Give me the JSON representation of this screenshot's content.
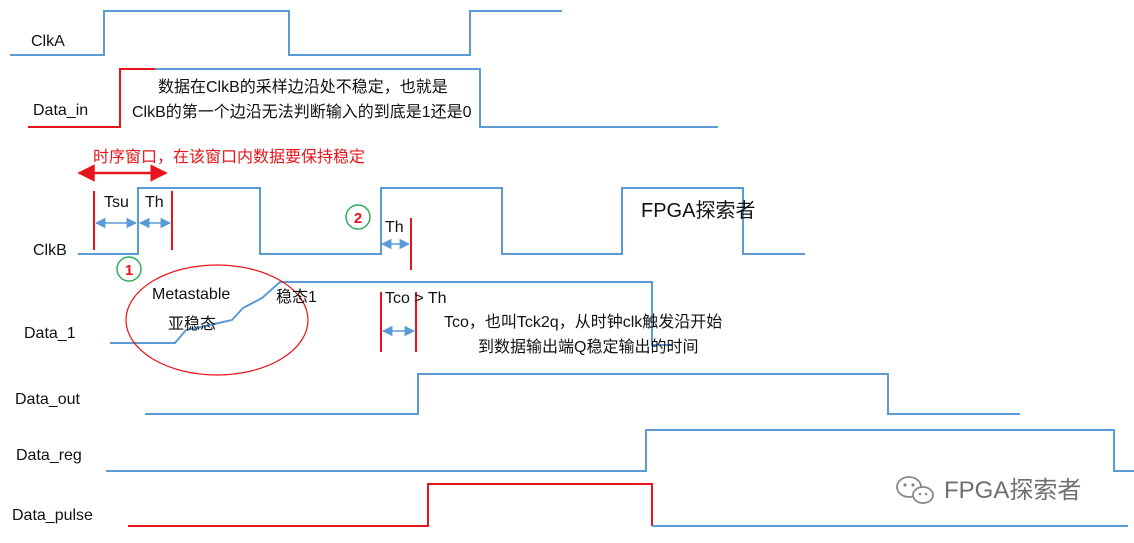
{
  "signals": {
    "clka": "ClkA",
    "data_in": "Data_in",
    "clkb": "ClkB",
    "data_1": "Data_1",
    "data_out": "Data_out",
    "data_reg": "Data_reg",
    "data_pulse": "Data_pulse"
  },
  "annotations": {
    "unstable_line1": "数据在ClkB的采样边沿处不稳定，也就是",
    "unstable_line2": "ClkB的第一个边沿无法判断输入的到底是1还是0",
    "timing_window": "时序窗口，在该窗口内数据要保持稳定",
    "tsu": "Tsu",
    "th1": "Th",
    "th2": "Th",
    "badge1": "1",
    "badge2": "2",
    "metastable_en": "Metastable",
    "metastable_zh": "亚稳态",
    "stable1": "稳态1",
    "tco_gt_th": "Tco > Th",
    "tco_line1": "Tco，也叫Tck2q，从时钟clk触发沿开始",
    "tco_line2": "到数据输出端Q稳定输出的时间",
    "brand": "FPGA探索者",
    "watermark": "FPGA探索者"
  },
  "colors": {
    "signal_blue": "#5b9bd5",
    "highlight_red": "#e8141b",
    "marker_green": "#2fae5a",
    "arrow_blue": "#5b9bd5"
  },
  "icons": {
    "watermark_icon": "wechat-icon"
  }
}
